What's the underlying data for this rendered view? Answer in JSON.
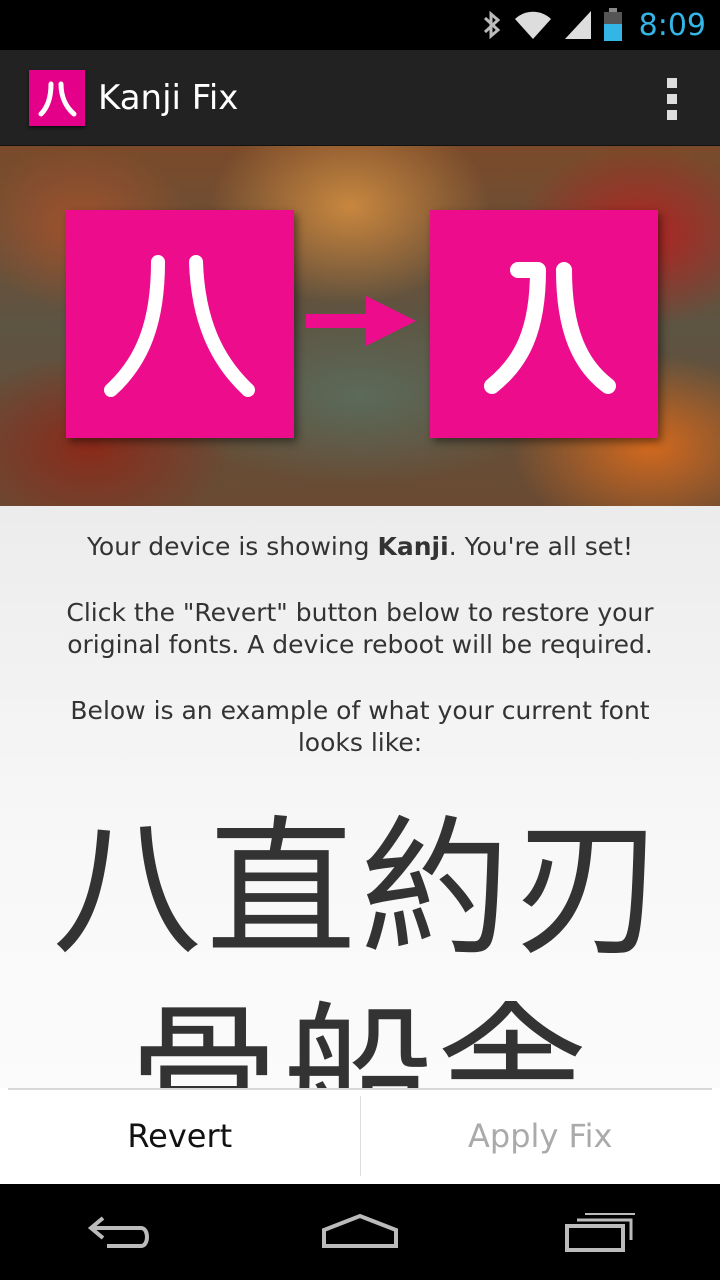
{
  "status_bar": {
    "time": "8:09",
    "icons": [
      "bluetooth-icon",
      "wifi-icon",
      "signal-icon",
      "battery-icon"
    ],
    "time_color": "#33b5e5"
  },
  "action_bar": {
    "app_icon_glyph": "八",
    "title": "Kanji Fix",
    "overflow_icon": "overflow-menu-icon"
  },
  "hero": {
    "before_glyph": "八",
    "after_glyph": "八",
    "accent_color": "#ec0c8c"
  },
  "content": {
    "status_prefix": "Your device is showing ",
    "status_bold": "Kanji",
    "status_suffix": ". You're all set!",
    "revert_info": "Click the \"Revert\" button below to restore your original fonts. A device reboot will be required.",
    "example_intro": "Below is an example of what your current font looks like:",
    "sample_line1": "八直約刃",
    "sample_line2": "骨船舎"
  },
  "buttons": {
    "revert_label": "Revert",
    "apply_label": "Apply Fix"
  },
  "nav_bar": {
    "icons": [
      "back-icon",
      "home-icon",
      "recent-apps-icon"
    ]
  }
}
